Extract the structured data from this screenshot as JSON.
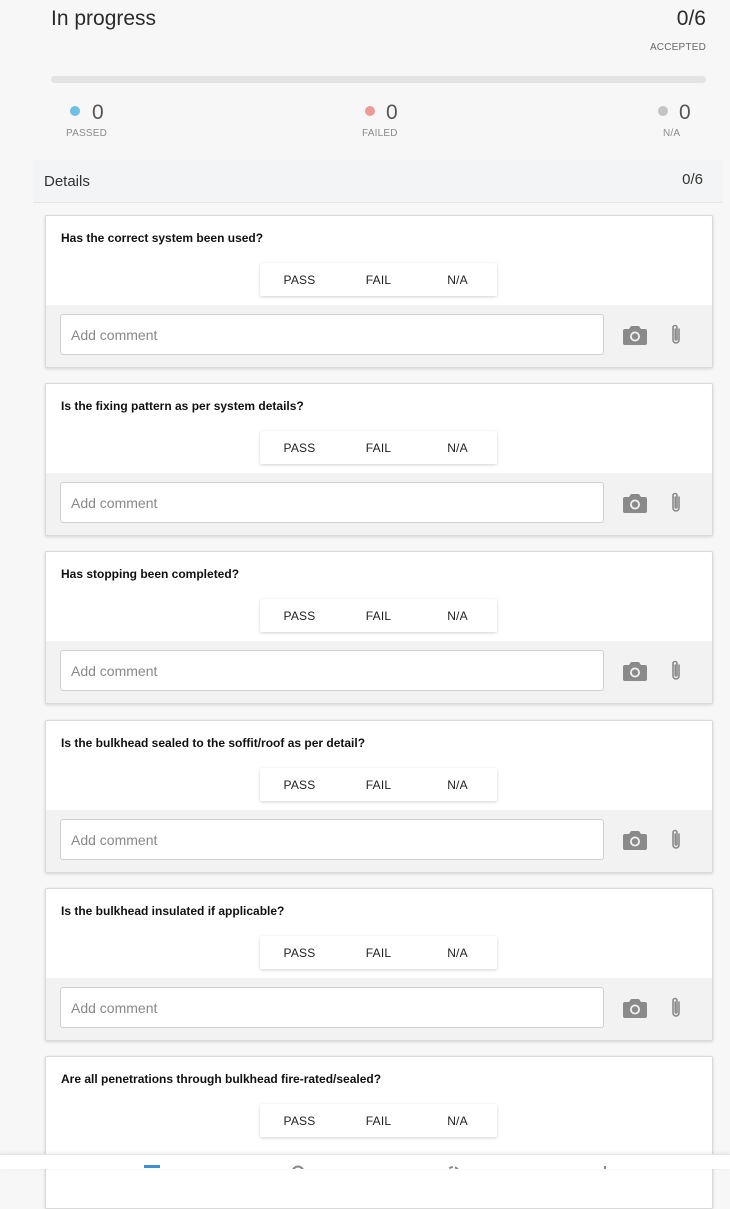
{
  "header": {
    "title": "In progress",
    "accepted_value": "0/6",
    "accepted_label": "ACCEPTED",
    "progress_fraction": 0
  },
  "stats": [
    {
      "key": "passed",
      "value": "0",
      "label": "PASSED",
      "color": "#6ec1e4"
    },
    {
      "key": "failed",
      "value": "0",
      "label": "FAILED",
      "color": "#ef9a9a"
    },
    {
      "key": "na",
      "value": "0",
      "label": "N/A",
      "color": "#c4c4c4"
    }
  ],
  "details": {
    "title": "Details",
    "count": "0/6"
  },
  "buttons": {
    "pass": "PASS",
    "fail": "FAIL",
    "na": "N/A"
  },
  "comment_placeholder": "Add comment",
  "items": [
    {
      "question": "Has the correct system been used?"
    },
    {
      "question": "Is the fixing pattern as per system details?"
    },
    {
      "question": "Has stopping been completed?"
    },
    {
      "question": "Is the bulkhead sealed to the soffit/roof as per detail?"
    },
    {
      "question": "Is the bulkhead insulated if applicable?"
    },
    {
      "question": "Are all penetrations through bulkhead fire-rated/sealed?"
    }
  ],
  "bottom_nav": [
    {
      "icon": "list-icon"
    },
    {
      "icon": "search-icon"
    },
    {
      "icon": "sync-icon"
    },
    {
      "icon": "add-icon"
    }
  ]
}
